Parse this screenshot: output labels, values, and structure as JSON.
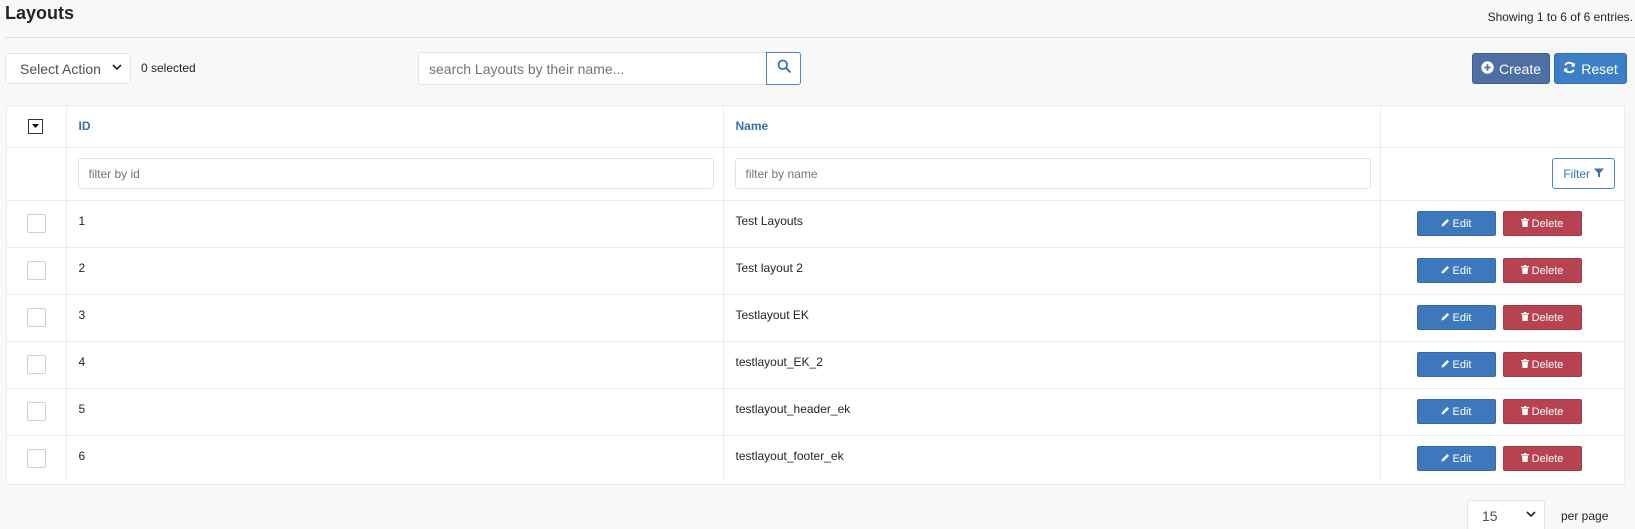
{
  "header": {
    "title": "Layouts",
    "entries_info": "Showing 1 to 6 of 6 entries."
  },
  "toolbar": {
    "select_action_label": "Select Action",
    "selected_count": "0 selected",
    "search_placeholder": "search Layouts by their name...",
    "create_label": "Create",
    "reset_label": "Reset"
  },
  "table": {
    "columns": {
      "id": "ID",
      "name": "Name"
    },
    "filters": {
      "id_placeholder": "filter by id",
      "name_placeholder": "filter by name",
      "filter_label": "Filter"
    },
    "edit_label": "Edit",
    "delete_label": "Delete",
    "rows": [
      {
        "id": "1",
        "name": "Test Layouts"
      },
      {
        "id": "2",
        "name": "Test layout 2"
      },
      {
        "id": "3",
        "name": "Testlayout EK"
      },
      {
        "id": "4",
        "name": "testlayout_EK_2"
      },
      {
        "id": "5",
        "name": "testlayout_header_ek"
      },
      {
        "id": "6",
        "name": "testlayout_footer_ek"
      }
    ]
  },
  "footer": {
    "per_page_value": "15",
    "per_page_label": "per page"
  },
  "colors": {
    "primary": "#3d78bd",
    "create": "#4d6fa3",
    "reset": "#3d7fc5",
    "danger": "#b84350",
    "link": "#3a6fb0"
  },
  "icons": {
    "search": "search-icon",
    "create": "plus-circle-icon",
    "reset": "refresh-icon",
    "filter": "filter-icon",
    "edit": "pencil-icon",
    "delete": "trash-icon"
  }
}
